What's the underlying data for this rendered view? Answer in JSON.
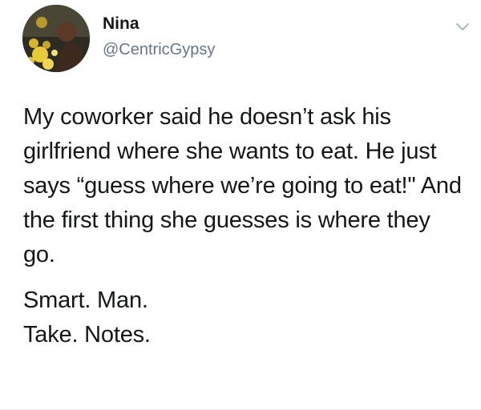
{
  "author": {
    "display_name": "Nina",
    "handle": "@CentricGypsy"
  },
  "tweet": {
    "paragraph_1": "My coworker said he doesn’t ask his girlfriend where she wants to eat. He just says “guess where we’re going to eat!\" And the first thing she guesses is where they go.",
    "line_2": "Smart. Man.",
    "line_3": "Take. Notes."
  },
  "icons": {
    "avatar": "profile-photo",
    "menu": "chevron-down-icon"
  },
  "colors": {
    "text": "#14171a",
    "secondary_text": "#657786",
    "caret": "#aab8c2"
  }
}
